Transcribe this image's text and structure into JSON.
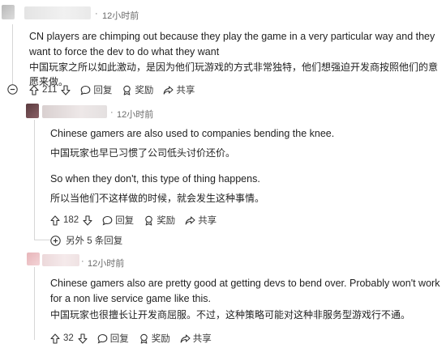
{
  "comments": [
    {
      "time": "12小时前",
      "text_en": "CN players are chimping out because they play the game in a very particular way and they want to force the dev to do what they want",
      "text_zh": "中国玩家之所以如此激动，是因为他们玩游戏的方式非常独特，他们想强迫开发商按照他们的意愿来做。",
      "votes": "211",
      "reply_label": "回复",
      "award_label": "奖励",
      "share_label": "共享"
    },
    {
      "time": "12小时前",
      "text_en_1": "Chinese gamers are also used to companies bending the knee.",
      "text_zh_1": "中国玩家也早已习惯了公司低头讨价还价。",
      "text_en_2": "So when they don't, this type of thing happens.",
      "text_zh_2": "所以当他们不这样做的时候，就会发生这种事情。",
      "votes": "182",
      "reply_label": "回复",
      "award_label": "奖励",
      "share_label": "共享",
      "more_replies": "另外 5 条回复"
    },
    {
      "time": "12小时前",
      "text_en": "Chinese gamers also are pretty good at getting devs to bend over. Probably won't work for a non live service game like this.",
      "text_zh": "中国玩家也很擅长让开发商屈服。不过，这种策略可能对这种非服务型游戏行不通。",
      "votes": "32",
      "reply_label": "回复",
      "award_label": "奖励",
      "share_label": "共享"
    }
  ],
  "icons": [
    "upvote-icon",
    "downvote-icon",
    "comment-icon",
    "award-icon",
    "share-icon",
    "collapse-icon",
    "expand-icon"
  ]
}
